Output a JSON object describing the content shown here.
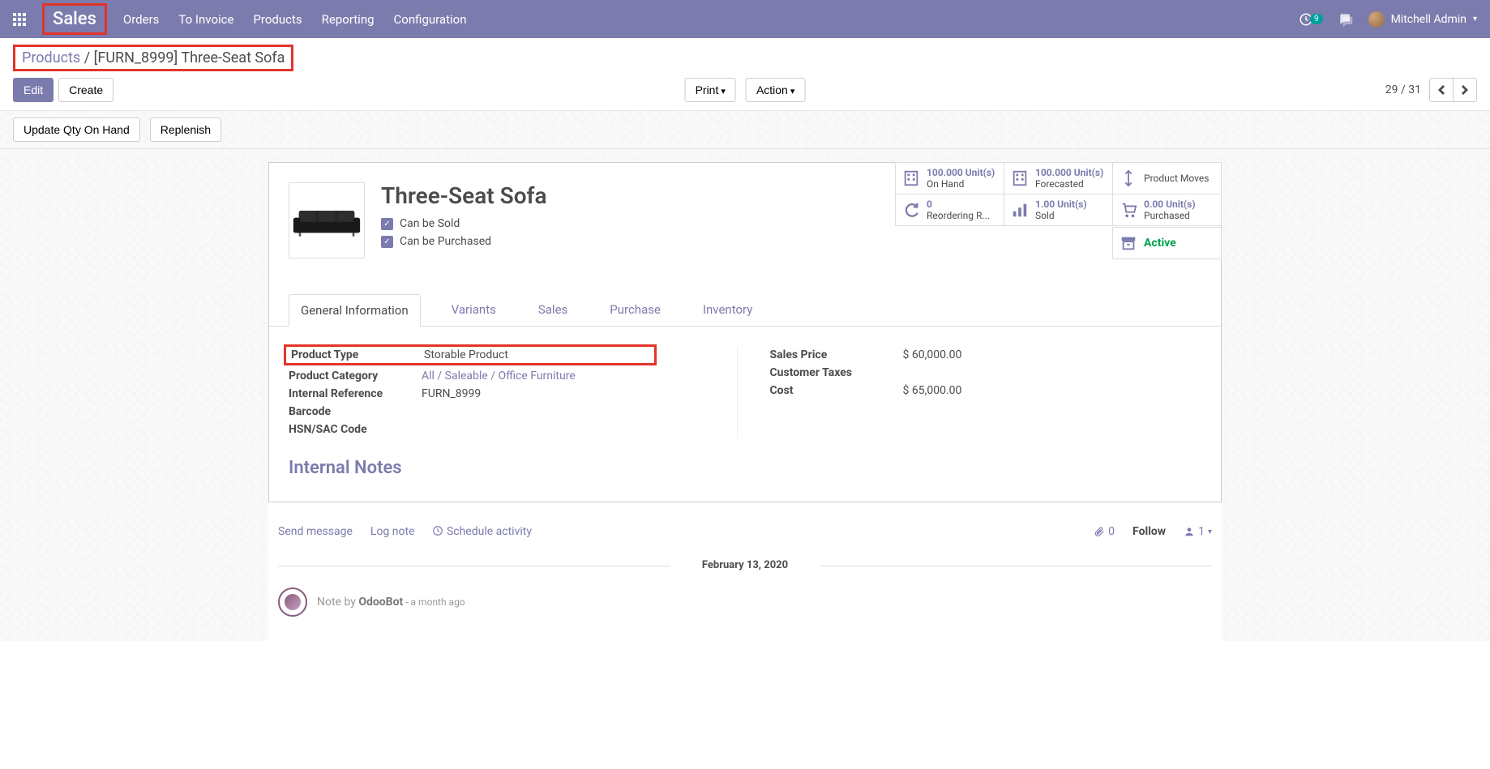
{
  "topnav": {
    "brand": "Sales",
    "menu": [
      "Orders",
      "To Invoice",
      "Products",
      "Reporting",
      "Configuration"
    ],
    "sync_count": "9",
    "user_name": "Mitchell Admin"
  },
  "breadcrumb": {
    "parent": "Products",
    "current": "[FURN_8999] Three-Seat Sofa"
  },
  "buttons": {
    "edit": "Edit",
    "create": "Create",
    "print": "Print",
    "action": "Action"
  },
  "pager": {
    "text": "29 / 31"
  },
  "status_buttons": {
    "update_qty": "Update Qty On Hand",
    "replenish": "Replenish"
  },
  "stat": {
    "onhand_val": "100.000 Unit(s)",
    "onhand_lbl": "On Hand",
    "forecast_val": "100.000 Unit(s)",
    "forecast_lbl": "Forecasted",
    "moves_lbl": "Product Moves",
    "reorder_val": "0",
    "reorder_lbl": "Reordering R...",
    "sold_val": "1.00 Unit(s)",
    "sold_lbl": "Sold",
    "purchased_val": "0.00 Unit(s)",
    "purchased_lbl": "Purchased",
    "active_lbl": "Active"
  },
  "product": {
    "name": "Three-Seat Sofa",
    "can_be_sold": "Can be Sold",
    "can_be_purchased": "Can be Purchased"
  },
  "tabs": [
    "General Information",
    "Variants",
    "Sales",
    "Purchase",
    "Inventory"
  ],
  "fields": {
    "left": {
      "product_type_lbl": "Product Type",
      "product_type_val": "Storable Product",
      "category_lbl": "Product Category",
      "category_val": "All / Saleable / Office Furniture",
      "internal_ref_lbl": "Internal Reference",
      "internal_ref_val": "FURN_8999",
      "barcode_lbl": "Barcode",
      "hsn_lbl": "HSN/SAC Code"
    },
    "right": {
      "sales_price_lbl": "Sales Price",
      "sales_price_val": "$ 60,000.00",
      "customer_taxes_lbl": "Customer Taxes",
      "cost_lbl": "Cost",
      "cost_val": "$ 65,000.00"
    }
  },
  "section": {
    "internal_notes": "Internal Notes"
  },
  "chatter": {
    "send_message": "Send message",
    "log_note": "Log note",
    "schedule_activity": "Schedule activity",
    "attachments": "0",
    "follow": "Follow",
    "followers_count": "1",
    "date": "February 13, 2020",
    "note_by": "Note by ",
    "note_author": "OdooBot",
    "note_time": " - a month ago"
  }
}
